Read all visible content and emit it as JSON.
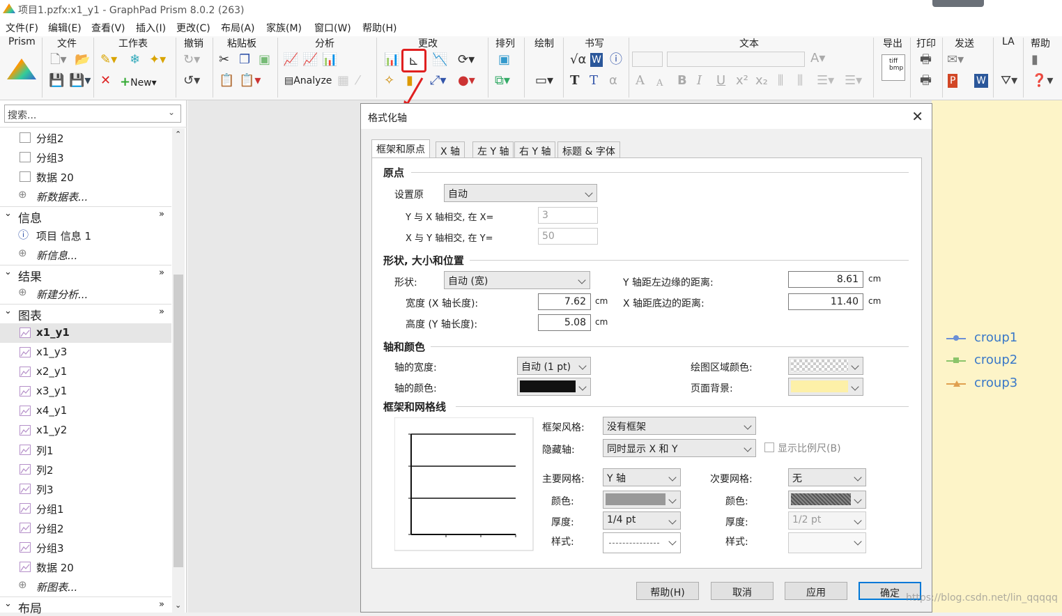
{
  "window_title": "项目1.pzfx:x1_y1 - GraphPad Prism 8.0.2 (263)",
  "menu": [
    "文件(F)",
    "编辑(E)",
    "查看(V)",
    "插入(I)",
    "更改(C)",
    "布局(A)",
    "家族(M)",
    "窗口(W)",
    "帮助(H)"
  ],
  "ribbon_groups": [
    "Prism",
    "文件",
    "工作表",
    "撤销",
    "粘贴板",
    "分析",
    "更改",
    "排列",
    "绘制",
    "书写",
    "文本",
    "导出",
    "打印",
    "发送",
    "LA",
    "帮助"
  ],
  "ribbon_buttons": {
    "new": "New",
    "analyze": "Analyze"
  },
  "sidebar": {
    "search_placeholder": "搜索...",
    "top_items": [
      "分组2",
      "分组3",
      "数据 20"
    ],
    "new_data": "新数据表...",
    "info_header": "信息",
    "info_items": [
      "项目 信息 1"
    ],
    "new_info": "新信息...",
    "results_header": "结果",
    "new_analysis": "新建分析...",
    "graphs_header": "图表",
    "graphs": [
      "x1_y1",
      "x1_y3",
      "x2_y1",
      "x3_y1",
      "x4_y1",
      "x1_y2",
      "列1",
      "列2",
      "列3",
      "分组1",
      "分组2",
      "分组3",
      "数据 20"
    ],
    "new_graph": "新图表...",
    "layout_header": "布局"
  },
  "legend": [
    {
      "name": "croup1",
      "color": "#6b8fd6"
    },
    {
      "name": "croup2",
      "color": "#8bc46a"
    },
    {
      "name": "croup3",
      "color": "#e0a050"
    }
  ],
  "dialog": {
    "title": "格式化轴",
    "tabs": [
      "框架和原点",
      "X 轴",
      "左 Y 轴",
      "右 Y 轴",
      "标题 & 字体"
    ],
    "origin": {
      "header": "原点",
      "set_label": "设置原",
      "set_value": "自动",
      "y_cross_label": "Y 与 X 轴相交, 在 X=",
      "y_cross_value": "3",
      "x_cross_label": "X 与 Y 轴相交, 在 Y=",
      "x_cross_value": "50"
    },
    "shape": {
      "header": "形状, 大小和位置",
      "shape_label": "形状:",
      "shape_value": "自动 (宽)",
      "width_label": "宽度 (X 轴长度):",
      "width_value": "7.62",
      "height_label": "高度 (Y 轴长度):",
      "height_value": "5.08",
      "y_left_label": "Y 轴距左边缘的距离:",
      "y_left_value": "8.61",
      "x_bottom_label": "X 轴距底边的距离:",
      "x_bottom_value": "11.40",
      "unit": "cm"
    },
    "axes_color": {
      "header": "轴和颜色",
      "thickness_label": "轴的宽度:",
      "thickness_value": "自动 (1 pt)",
      "color_label": "轴的颜色:",
      "plot_area_label": "绘图区域颜色:",
      "page_bg_label": "页面背景:"
    },
    "frame_grid": {
      "header": "框架和网格线",
      "frame_style_label": "框架风格:",
      "frame_style_value": "没有框架",
      "hide_axis_label": "隐藏轴:",
      "hide_axis_value": "同时显示 X 和 Y",
      "show_scale_label": "显示比例尺(B)",
      "major_grid_label": "主要网格:",
      "major_grid_value": "Y 轴",
      "minor_grid_label": "次要网格:",
      "minor_grid_value": "无",
      "color_label": "颜色:",
      "thickness_label": "厚度:",
      "major_thickness": "1/4 pt",
      "minor_thickness": "1/2 pt",
      "style_label": "样式:"
    },
    "buttons": {
      "help": "帮助(H)",
      "cancel": "取消",
      "apply": "应用",
      "ok": "确定"
    }
  },
  "watermark": "https://blog.csdn.net/lin_qqqqq"
}
